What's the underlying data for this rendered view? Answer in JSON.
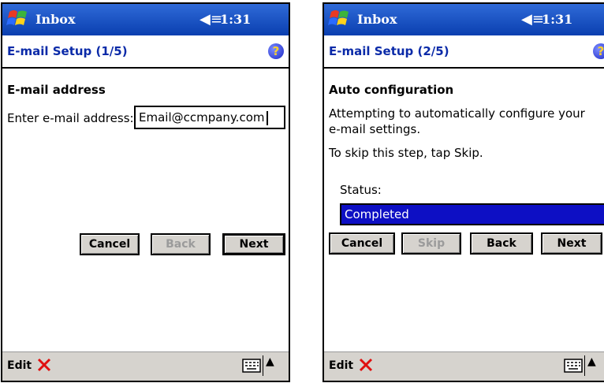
{
  "screens": [
    {
      "title": "Inbox",
      "time": "1:31",
      "header": "E-mail Setup (1/5)",
      "section": "E-mail address",
      "field_label": "Enter e-mail address:",
      "field_value": "Email@ccmpany.com",
      "buttons": {
        "cancel": "Cancel",
        "back": "Back",
        "next": "Next"
      },
      "bottom": {
        "edit": "Edit"
      }
    },
    {
      "title": "Inbox",
      "time": "1:31",
      "header": "E-mail Setup (2/5)",
      "section": "Auto configuration",
      "line1": "Attempting to automatically configure your",
      "line2": "e-mail settings.",
      "line3": "To skip this step, tap Skip.",
      "status_label": "Status:",
      "status_value": "Completed",
      "buttons": {
        "cancel": "Cancel",
        "skip": "Skip",
        "back": "Back",
        "next": "Next"
      },
      "bottom": {
        "edit": "Edit"
      }
    }
  ],
  "icons": [
    "windows-flag-icon",
    "speaker-icon",
    "help-icon",
    "delete-x-icon",
    "keyboard-icon",
    "up-arrow-icon"
  ],
  "colors": {
    "titlebar": "#0a3fb0",
    "header_text": "#0a2aa8",
    "status_bg": "#0d0fc4",
    "x_icon": "#e01010"
  }
}
